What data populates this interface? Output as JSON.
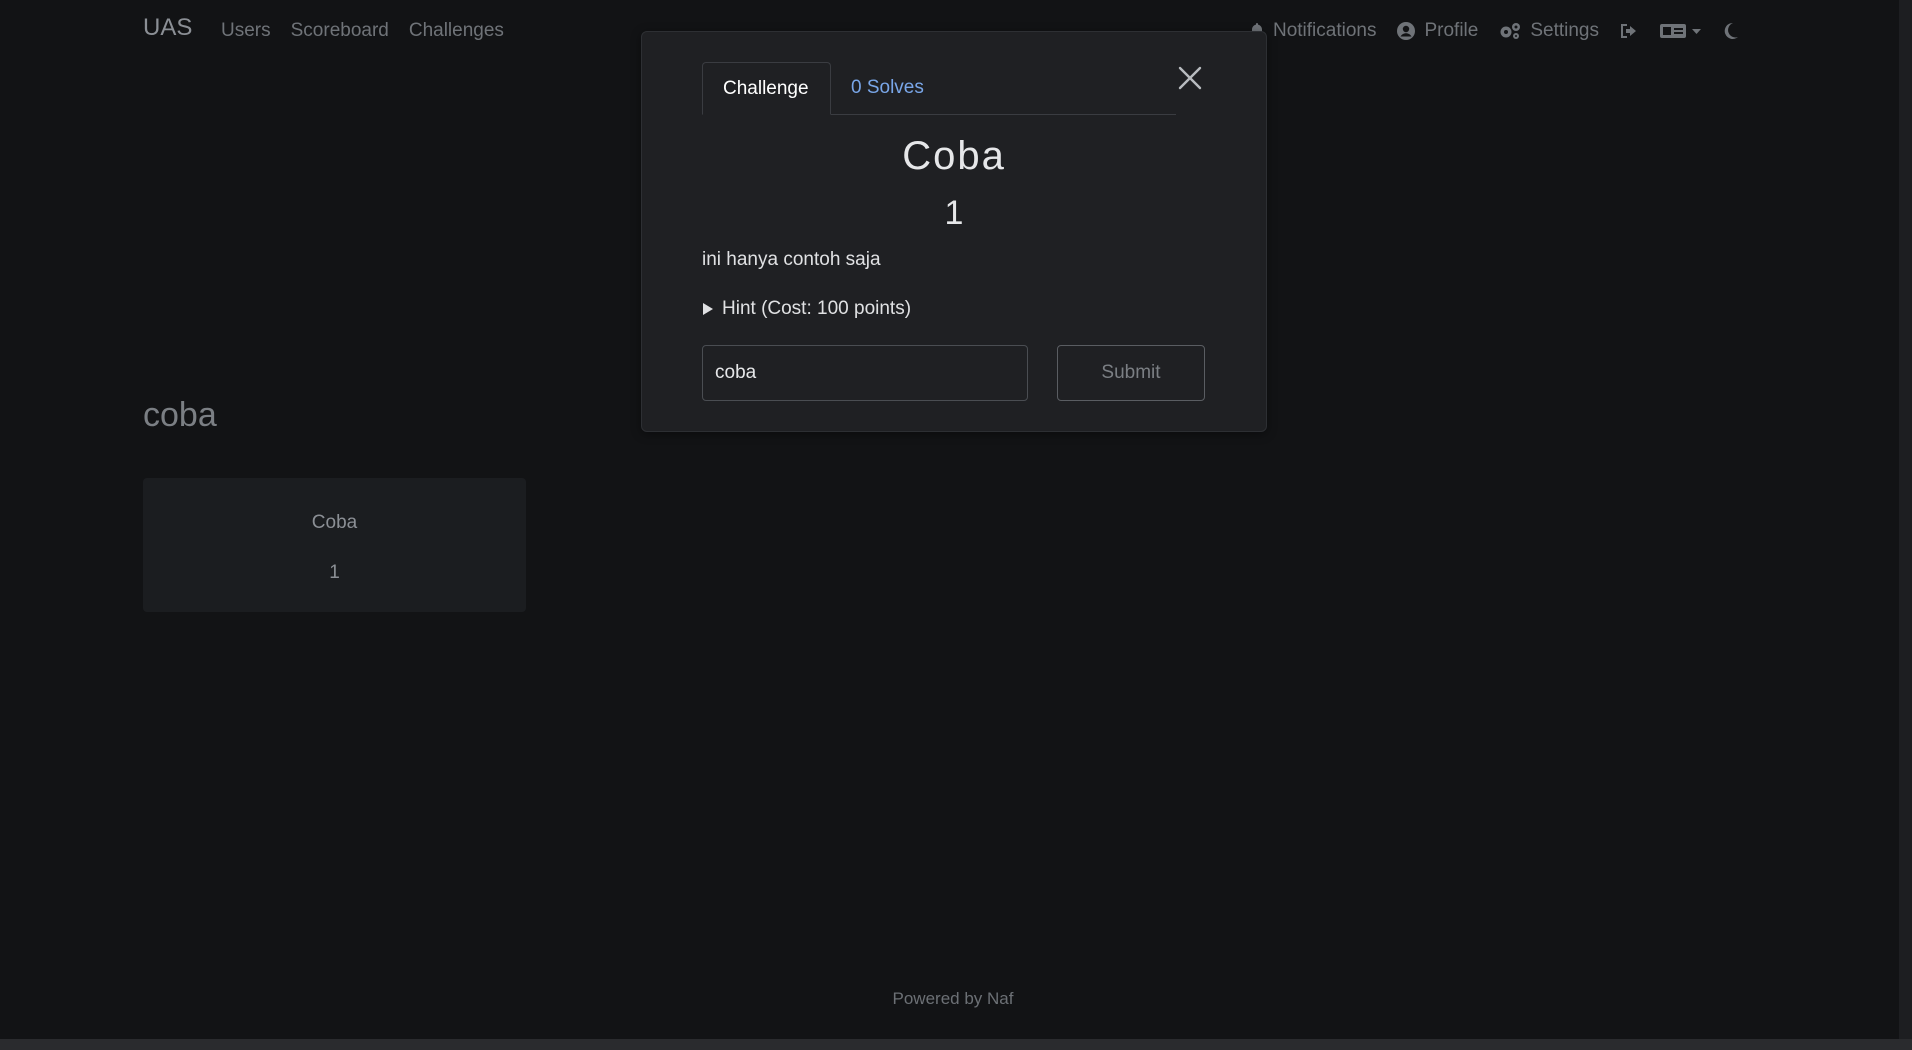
{
  "navbar": {
    "brand": "UAS",
    "links": [
      "Users",
      "Scoreboard",
      "Challenges"
    ],
    "notifications": "Notifications",
    "profile": "Profile",
    "settings": "Settings"
  },
  "icons": {
    "notifications": "bell-icon",
    "profile": "user-circle-icon",
    "settings": "gears-icon",
    "logout": "sign-out-icon",
    "language": "language-icon",
    "theme": "moon-icon",
    "close": "close-icon",
    "hint": "triangle-right-icon"
  },
  "page": {
    "category": "coba",
    "card": {
      "name": "Coba",
      "value": "1"
    },
    "footer": "Powered by Naf"
  },
  "modal": {
    "tabs": {
      "challenge": "Challenge",
      "solves": "0 Solves"
    },
    "title": "Coba",
    "value": "1",
    "description": "ini hanya contoh saja",
    "hint": "Hint (Cost: 100 points)",
    "input_value": "coba",
    "submit": "Submit"
  },
  "colors": {
    "background": "#121315",
    "modal": "#1f2023",
    "link_accent": "#79a6e8"
  }
}
